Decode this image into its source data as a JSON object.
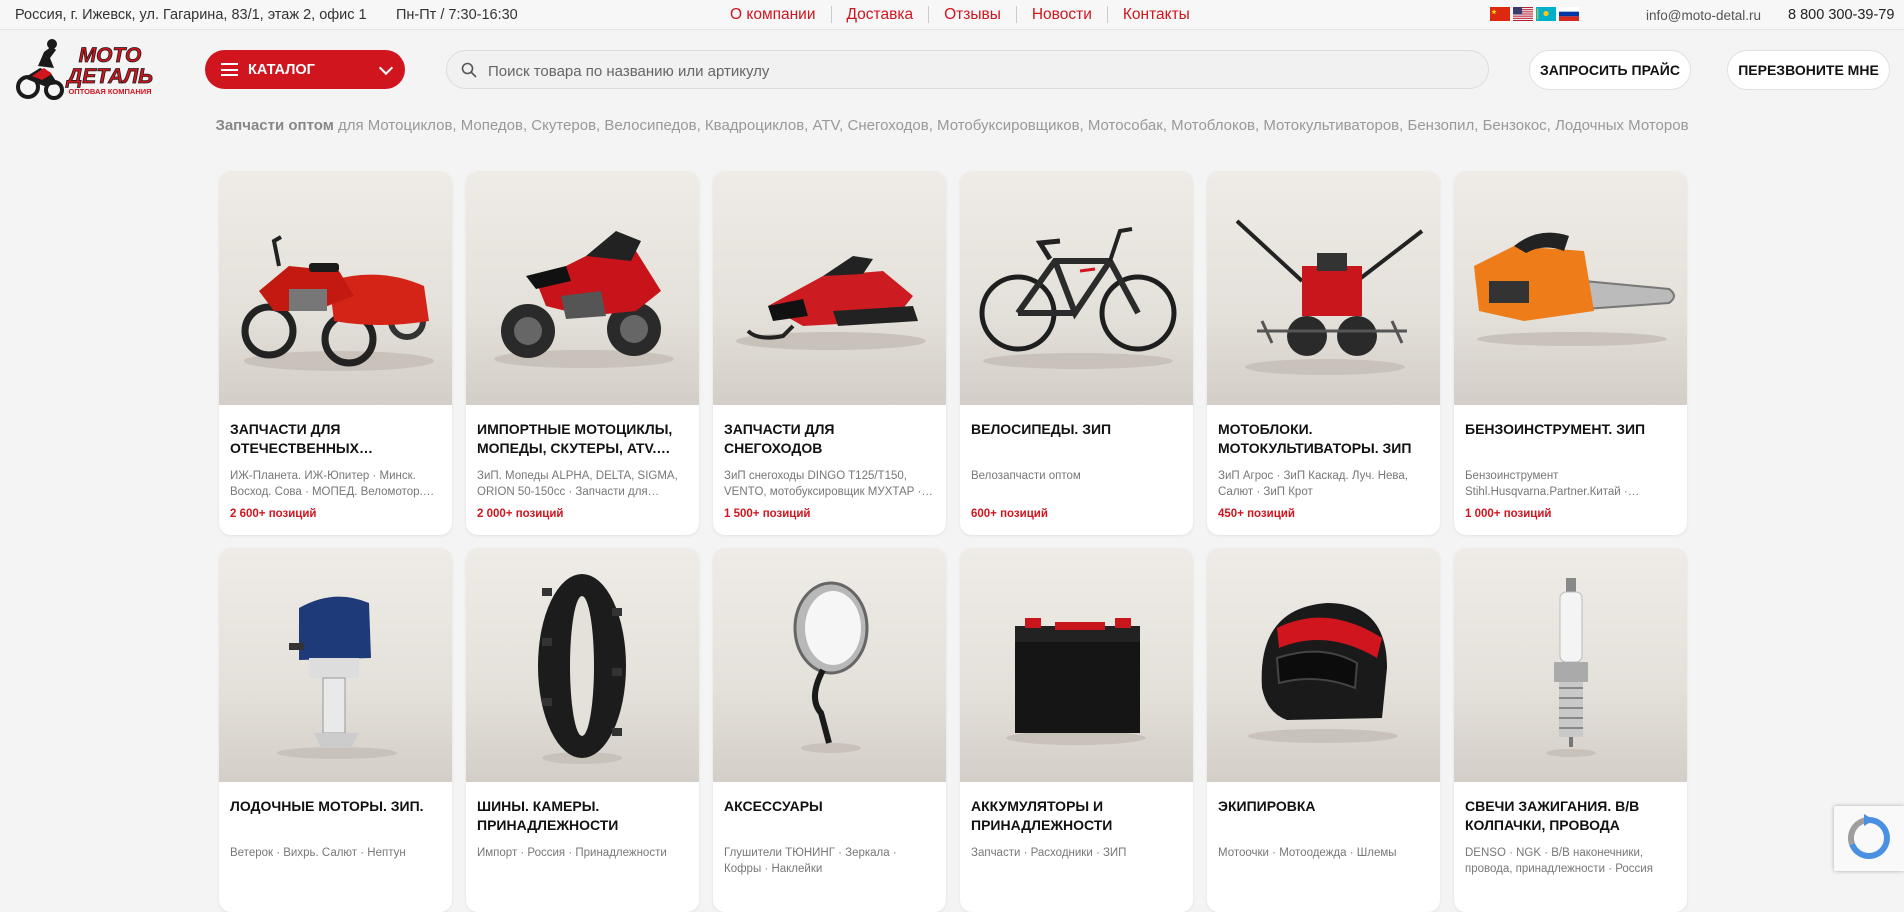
{
  "topbar": {
    "address": "Россия, г. Ижевск, ул. Гагарина, 83/1, этаж 2, офис 1",
    "hours": "Пн-Пт / 7:30-16:30",
    "nav": [
      "О компании",
      "Доставка",
      "Отзывы",
      "Новости",
      "Контакты"
    ],
    "languages": [
      "cn-flag-icon",
      "us-flag-icon",
      "kz-flag-icon",
      "ru-flag-icon"
    ],
    "email": "info@moto-detal.ru",
    "phone": "8 800 300-39-79"
  },
  "header": {
    "logo_line1": "МОТО",
    "logo_line2": "ДЕТАЛЬ",
    "logo_tagline": "ОПТОВАЯ КОМПАНИЯ",
    "catalog_label": "КАТАЛОГ",
    "search_placeholder": "Поиск товара по названию или артикулу",
    "request_price_label": "ЗАПРОСИТЬ ПРАЙС",
    "callback_label": "ПЕРЕЗВОНИТЕ МНЕ"
  },
  "tagline": {
    "bold": "Запчасти оптом",
    "rest": " для Мотоциклов, Мопедов, Скутеров, Велосипедов, Квадроциклов, ATV, Снегоходов, Мотобуксировщиков, Мотособак, Мотоблоков, Мотокультиваторов, Бензопил, Бензокос, Лодочных Моторов"
  },
  "colors": {
    "accent": "#d0151f",
    "page_bg": "#f4f4f4"
  },
  "categories": [
    {
      "title": "ЗАПЧАСТИ ДЛЯ ОТЕЧЕСТВЕННЫХ МОТОЦИКЛОВ",
      "subtitle": "ИЖ-Планета. ИЖ-Юпитер · Минск. Восход. Сова · МОПЕД. Веломотор. Карпаты",
      "count": "2 600+ позиций",
      "icon": "sidecar-motorcycle-image"
    },
    {
      "title": "ИМПОРТНЫЕ МОТОЦИКЛЫ, МОПЕДЫ, СКУТЕРЫ, ATV. ЗИП",
      "subtitle": "ЗиП. Мопеды ALPHA, DELTA, SIGMA, ORION 50-150cc · Запчасти для Скутеров",
      "count": "2 000+ позиций",
      "icon": "sport-motorcycle-image"
    },
    {
      "title": "ЗАПЧАСТИ ДЛЯ СНЕГОХОДОВ",
      "subtitle": "ЗиП снегоходы DINGO T125/T150, VENTO, мотобуксировщик МУХТАР · Снегоходы",
      "count": "1 500+ позиций",
      "icon": "snowmobile-image"
    },
    {
      "title": "ВЕЛОСИПЕДЫ. ЗИП",
      "subtitle": "Велозапчасти оптом",
      "count": "600+ позиций",
      "icon": "bicycle-image"
    },
    {
      "title": "МОТОБЛОКИ. МОТОКУЛЬТИВАТОРЫ. ЗИП",
      "subtitle": "ЗиП Агрос · ЗиП Каскад. Луч. Нева, Салют · ЗиП Крот",
      "count": "450+ позиций",
      "icon": "cultivator-image"
    },
    {
      "title": "БЕНЗОИНСТРУМЕНТ. ЗИП",
      "subtitle": "Бензоинструмент Stihl.Husqvarna.Partner.Китай · Режущие элементы",
      "count": "1 000+ позиций",
      "icon": "chainsaw-image"
    },
    {
      "title": "ЛОДОЧНЫЕ МОТОРЫ. ЗИП.",
      "subtitle": "Ветерок · Вихрь. Салют · Нептун",
      "count": "",
      "icon": "outboard-motor-image"
    },
    {
      "title": "ШИНЫ. КАМЕРЫ. ПРИНАДЛЕЖНОСТИ",
      "subtitle": "Импорт · Россия · Принадлежности",
      "count": "",
      "icon": "tire-image"
    },
    {
      "title": "АКСЕССУАРЫ",
      "subtitle": "Глушители ТЮНИНГ · Зеркала · Кофры · Наклейки",
      "count": "",
      "icon": "mirror-image"
    },
    {
      "title": "АККУМУЛЯТОРЫ И ПРИНАДЛЕЖНОСТИ",
      "subtitle": "Запчасти · Расходники · ЗИП",
      "count": "",
      "icon": "battery-image"
    },
    {
      "title": "ЭКИПИРОВКА",
      "subtitle": "Мотоочки · Мотоодежда · Шлемы",
      "count": "",
      "icon": "helmet-image"
    },
    {
      "title": "СВЕЧИ ЗАЖИГАНИЯ. В/В КОЛПАЧКИ, ПРОВОДА",
      "subtitle": "DENSO · NGK · В/В наконечники, провода, принадлежности · Россия",
      "count": "",
      "icon": "spark-plug-image"
    }
  ]
}
